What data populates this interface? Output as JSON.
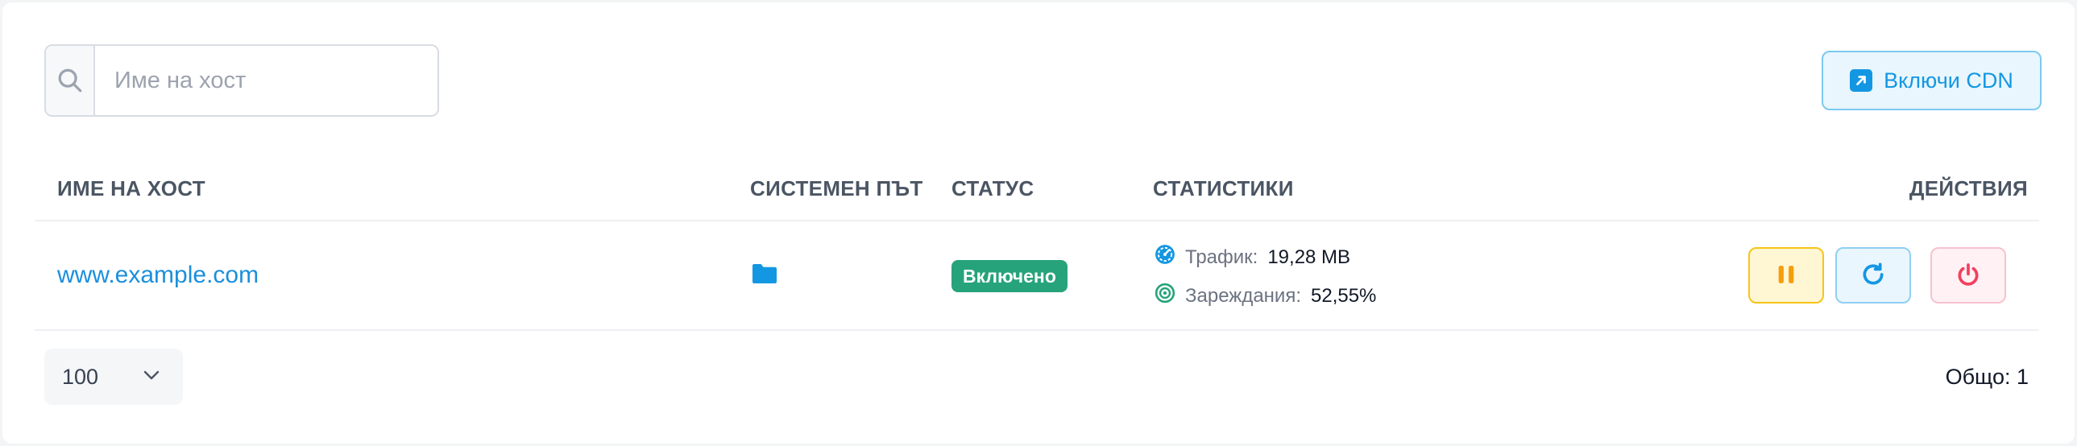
{
  "search": {
    "placeholder": "Име на хост",
    "icon": "search-icon"
  },
  "toolbar": {
    "cdn_label": "Включи CDN",
    "cdn_icon": "external-link-square-icon"
  },
  "table": {
    "columns": {
      "host": "ИМЕ НА ХОСТ",
      "path": "СИСТЕМЕН ПЪТ",
      "status": "СТАТУС",
      "stats": "СТАТИСТИКИ",
      "actions": "ДЕЙСТВИЯ"
    },
    "rows": [
      {
        "host": "www.example.com",
        "path_icon": "folder-icon",
        "status": "Включено",
        "traffic_label": "Трафик:",
        "traffic_value": "19,28 MB",
        "hits_label": "Зареждания:",
        "hits_value": "52,55%",
        "actions": [
          "pause-icon",
          "refresh-icon",
          "power-icon"
        ]
      }
    ]
  },
  "footer": {
    "page_size": "100",
    "total": "Общо: 1"
  },
  "colors": {
    "accent": "#1497e3",
    "link": "#1a8fdc",
    "status_on": "#26a37a",
    "pause": "#f59e0b",
    "power": "#f43f5e"
  }
}
